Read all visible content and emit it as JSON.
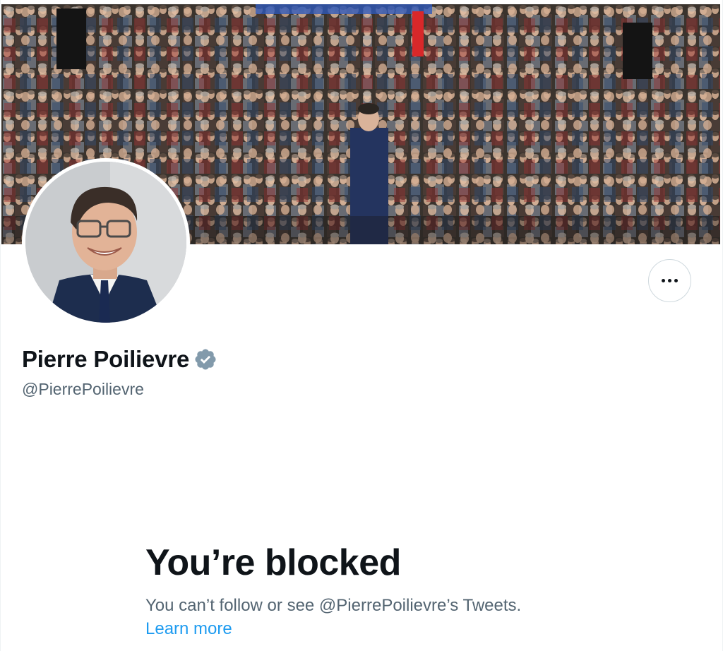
{
  "profile": {
    "display_name": "Pierre Poilievre",
    "handle": "@PierrePoilievre",
    "verified_badge": "verified-badge-icon",
    "verified_color": "#829aab"
  },
  "actions": {
    "more_icon": "more-horizontal-icon"
  },
  "blocked": {
    "title": "You’re blocked",
    "message": "You can’t follow or see @PierrePoilievre’s Tweets.",
    "learn_more": "Learn more",
    "link_color": "#1d9bf0"
  }
}
